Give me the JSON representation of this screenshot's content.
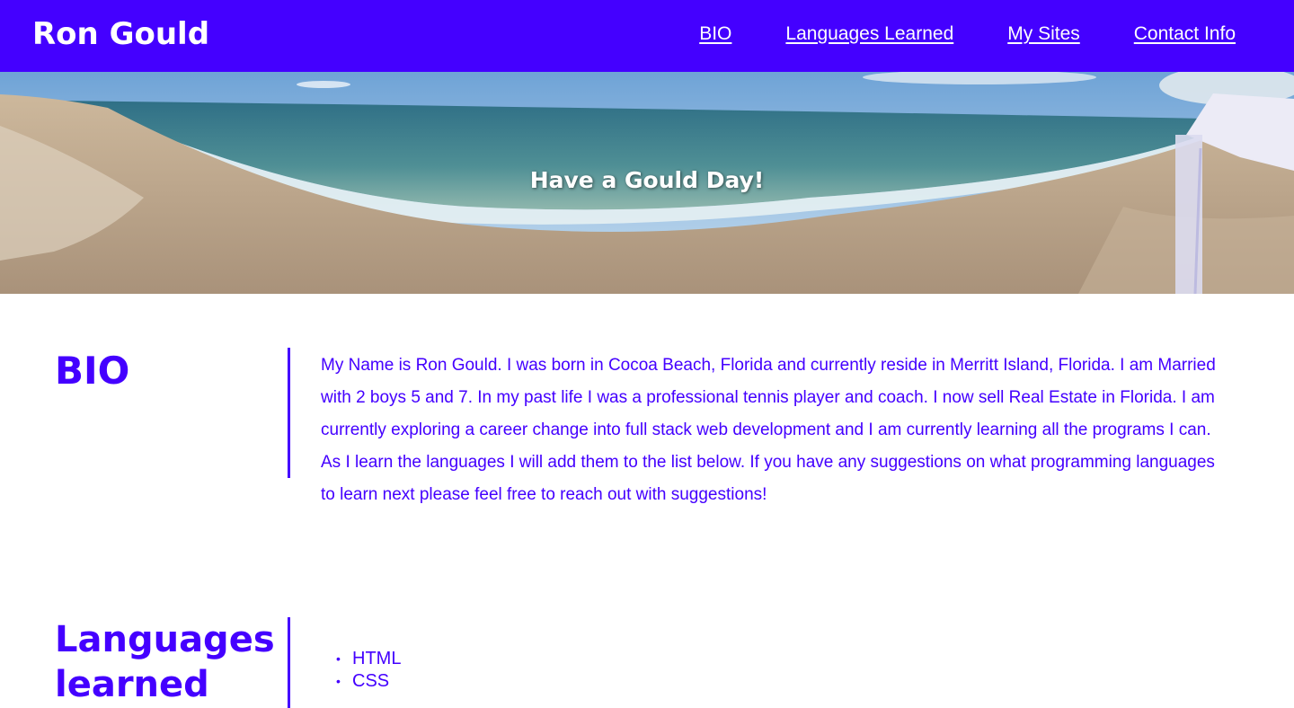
{
  "header": {
    "title": "Ron Gould",
    "nav": [
      {
        "label": "BIO"
      },
      {
        "label": "Languages Learned"
      },
      {
        "label": "My Sites"
      },
      {
        "label": "Contact Info"
      }
    ]
  },
  "hero": {
    "tagline": "Have a Gould Day!"
  },
  "bio": {
    "heading": "BIO",
    "text": "My Name is Ron Gould. I was born in Cocoa Beach, Florida and currently reside in Merritt Island, Florida. I am Married with 2 boys 5 and 7. In my past life I was a professional tennis player and coach. I now sell Real Estate in Florida. I am currently exploring a career change into full stack web development and I am currently learning all the programs I can. As I learn the languages I will add them to the list below. If you have any suggestions on what programming languages to learn next please feel free to reach out with suggestions!"
  },
  "languages": {
    "heading_line1": "Languages",
    "heading_line2": "learned",
    "items": [
      "HTML",
      "CSS"
    ]
  },
  "colors": {
    "brand": "#4400ff",
    "header_text": "#ffffff"
  }
}
